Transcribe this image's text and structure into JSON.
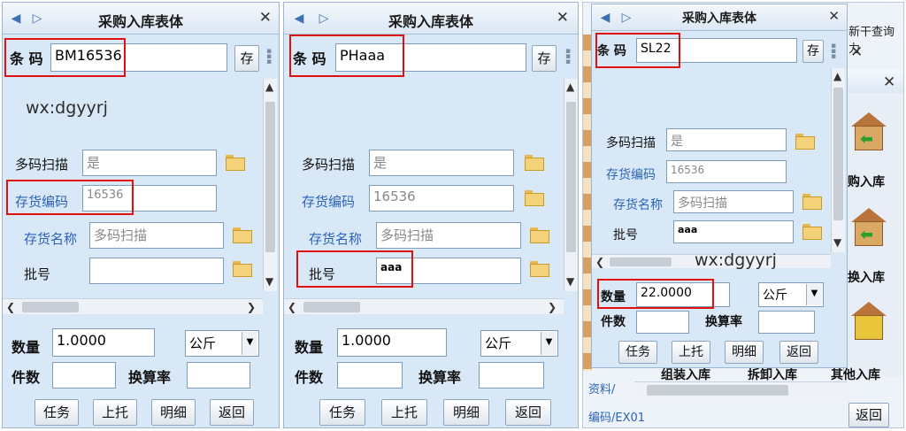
{
  "panel1": {
    "title": "采购入库表体",
    "barcode_label": "条 码",
    "barcode_value": "BM16536",
    "save_label": "存",
    "watermark": "wx:dgyyrj",
    "multi_scan_label": "多码扫描",
    "multi_scan_value": "是",
    "inv_code_label": "存货编码",
    "inv_code_value": "16536",
    "inv_name_label": "存货名称",
    "inv_name_value": "多码扫描",
    "batch_label": "批号",
    "batch_value": "",
    "qty_label": "数量",
    "qty_value": "1.0000",
    "unit_value": "公斤",
    "pieces_label": "件数",
    "rate_label": "换算率",
    "buttons": [
      "任务",
      "上托",
      "明细",
      "返回"
    ]
  },
  "panel2": {
    "title": "采购入库表体",
    "barcode_label": "条 码",
    "barcode_value": "PHaaa",
    "save_label": "存",
    "multi_scan_label": "多码扫描",
    "multi_scan_value": "是",
    "inv_code_label": "存货编码",
    "inv_code_value": "16536",
    "inv_name_label": "存货名称",
    "inv_name_value": "多码扫描",
    "batch_label": "批号",
    "batch_value": "aaa",
    "qty_label": "数量",
    "qty_value": "1.0000",
    "unit_value": "公斤",
    "pieces_label": "件数",
    "rate_label": "换算率",
    "buttons": [
      "任务",
      "上托",
      "明细",
      "返回"
    ]
  },
  "panel3": {
    "title": "采购入库表体",
    "barcode_label": "条 码",
    "barcode_value": "SL22",
    "save_label": "存",
    "watermark": "wx:dgyyrj",
    "multi_scan_label": "多码扫描",
    "multi_scan_value": "是",
    "inv_code_label": "存货编码",
    "inv_code_value": "16536",
    "inv_name_label": "存货名称",
    "inv_name_value": "多码扫描",
    "batch_label": "批号",
    "batch_value": "aaa",
    "qty_label": "数量",
    "qty_value": "22.0000",
    "unit_value": "公斤",
    "pieces_label": "件数",
    "rate_label": "换算率",
    "buttons": [
      "任务",
      "上托",
      "明细",
      "返回"
    ]
  },
  "background": {
    "top_text": "新干查询力",
    "menu_items": [
      "购入库",
      "换入库"
    ],
    "bottom_labels": [
      "组装入库",
      "拆卸入库",
      "其他入库"
    ],
    "side_text_1": "资料/",
    "side_text_2": "编码/EX01",
    "return_label": "返回"
  }
}
